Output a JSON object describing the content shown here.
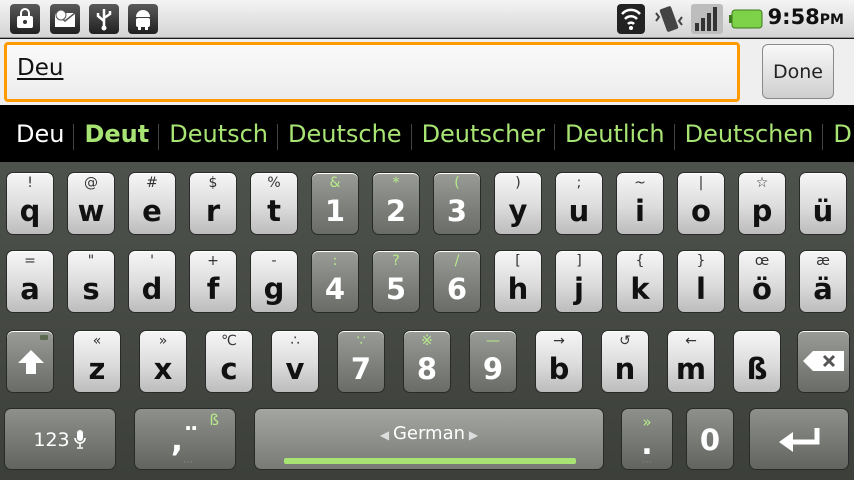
{
  "status_bar": {
    "left_icons": [
      "lock-bag-icon",
      "envelope-icon",
      "usb-icon",
      "android-debug-icon"
    ],
    "right_icons": [
      "wifi-icon",
      "vibrate-icon",
      "signal-icon",
      "battery-icon"
    ],
    "time": "9:58",
    "ampm": "PM"
  },
  "entry": {
    "text": "Deu",
    "done_label": "Done"
  },
  "suggestions": [
    {
      "text": "Deu",
      "kind": "typed"
    },
    {
      "text": "Deut",
      "kind": "best"
    },
    {
      "text": "Deutsch",
      "kind": "normal"
    },
    {
      "text": "Deutsche",
      "kind": "normal"
    },
    {
      "text": "Deutscher",
      "kind": "normal"
    },
    {
      "text": "Deutlich",
      "kind": "normal"
    },
    {
      "text": "Deutschen",
      "kind": "normal"
    },
    {
      "text": "D",
      "kind": "normal"
    }
  ],
  "keyboard": {
    "row1": [
      {
        "main": "q",
        "alt": "!"
      },
      {
        "main": "w",
        "alt": "@"
      },
      {
        "main": "e",
        "alt": "#"
      },
      {
        "main": "r",
        "alt": "$"
      },
      {
        "main": "t",
        "alt": "%"
      },
      {
        "main": "1",
        "alt": "&",
        "dark": true
      },
      {
        "main": "2",
        "alt": "*",
        "dark": true
      },
      {
        "main": "3",
        "alt": "(",
        "dark": true
      },
      {
        "main": "y",
        "alt": ")"
      },
      {
        "main": "u",
        "alt": ";"
      },
      {
        "main": "i",
        "alt": "~"
      },
      {
        "main": "o",
        "alt": "|"
      },
      {
        "main": "p",
        "alt": "☆"
      },
      {
        "main": "ü",
        "alt": ""
      }
    ],
    "row2": [
      {
        "main": "a",
        "alt": "="
      },
      {
        "main": "s",
        "alt": "\""
      },
      {
        "main": "d",
        "alt": "'"
      },
      {
        "main": "f",
        "alt": "+"
      },
      {
        "main": "g",
        "alt": "-"
      },
      {
        "main": "4",
        "alt": ":",
        "dark": true
      },
      {
        "main": "5",
        "alt": "?",
        "dark": true
      },
      {
        "main": "6",
        "alt": "/",
        "dark": true
      },
      {
        "main": "h",
        "alt": "["
      },
      {
        "main": "j",
        "alt": "]"
      },
      {
        "main": "k",
        "alt": "{"
      },
      {
        "main": "l",
        "alt": "}"
      },
      {
        "main": "ö",
        "alt": "œ"
      },
      {
        "main": "ä",
        "alt": "æ"
      }
    ],
    "row3": [
      {
        "main": "z",
        "alt": "«"
      },
      {
        "main": "x",
        "alt": "»"
      },
      {
        "main": "c",
        "alt": "℃"
      },
      {
        "main": "v",
        "alt": "∴"
      },
      {
        "main": "7",
        "alt": "∵",
        "dark": true
      },
      {
        "main": "8",
        "alt": "※",
        "dark": true
      },
      {
        "main": "9",
        "alt": "—",
        "dark": true
      },
      {
        "main": "b",
        "alt": "→"
      },
      {
        "main": "n",
        "alt": "↺"
      },
      {
        "main": "m",
        "alt": "←"
      },
      {
        "main": "ß",
        "alt": ""
      }
    ],
    "symbols_label": "123",
    "comma_alt": "ß",
    "space_label": "German",
    "period_alt": "»",
    "zero_label": "0"
  }
}
